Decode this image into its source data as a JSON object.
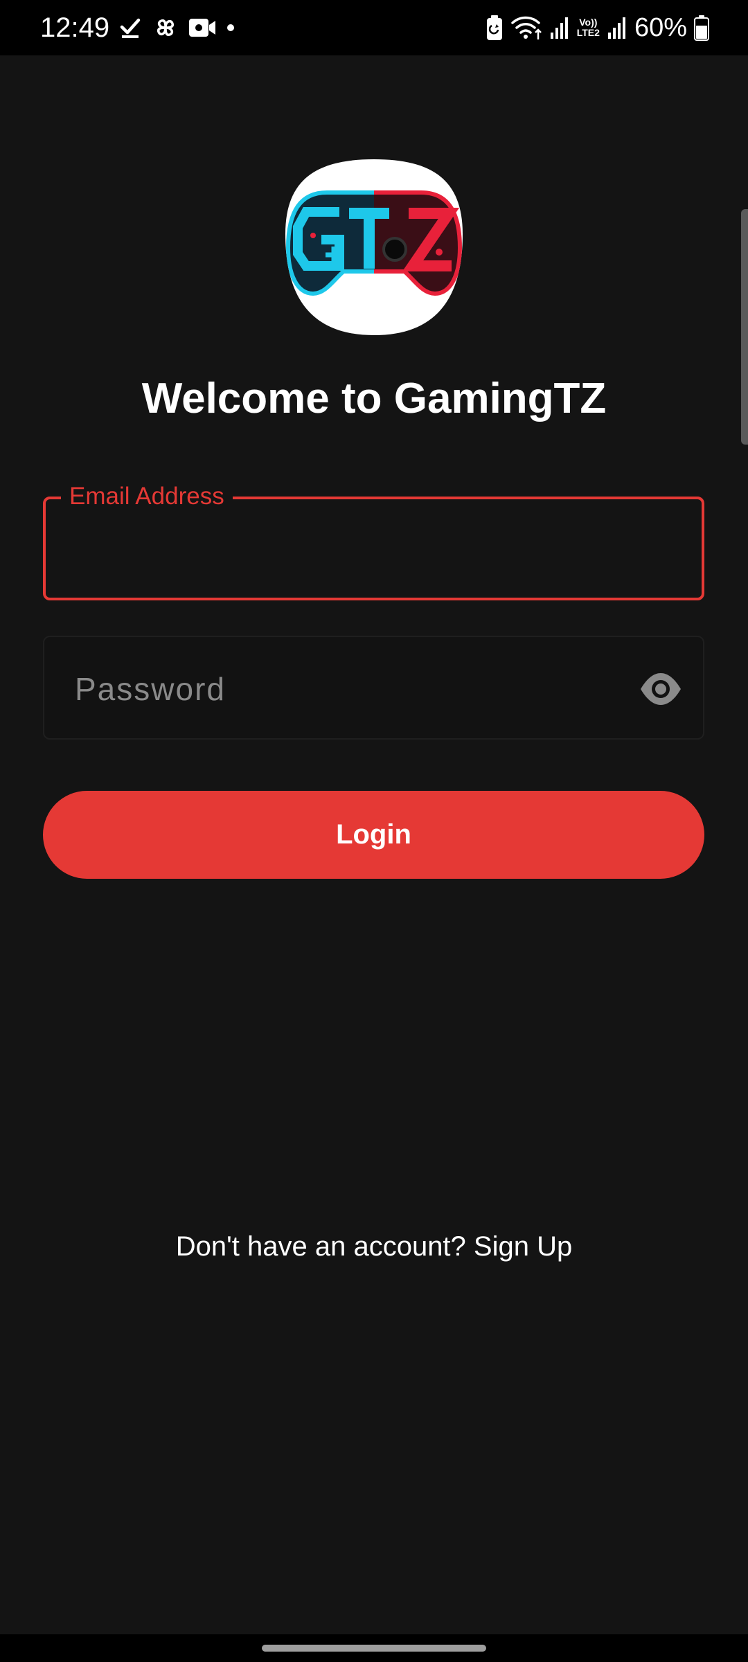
{
  "status_bar": {
    "time": "12:49",
    "battery_percent": "60%",
    "network_label_top": "Vo))",
    "network_label_bottom": "LTE2"
  },
  "app": {
    "title": "Welcome to GamingTZ",
    "logo_text": "GTZ"
  },
  "form": {
    "email_label": "Email Address",
    "email_value": "",
    "password_placeholder": "Password",
    "login_label": "Login"
  },
  "signup": {
    "prompt": "Don't have an account?",
    "link": "Sign Up"
  },
  "colors": {
    "accent": "#e53935",
    "background": "#141414",
    "logo_cyan": "#1ec8ea",
    "logo_red": "#e8213a"
  },
  "icons": {
    "status_left": [
      "check-icon",
      "pinwheel-icon",
      "video-camera-icon",
      "dot-icon"
    ],
    "status_right": [
      "battery-saver-icon",
      "wifi-icon",
      "signal-icon",
      "signal-icon",
      "battery-icon"
    ],
    "password_toggle": "eye-icon"
  }
}
